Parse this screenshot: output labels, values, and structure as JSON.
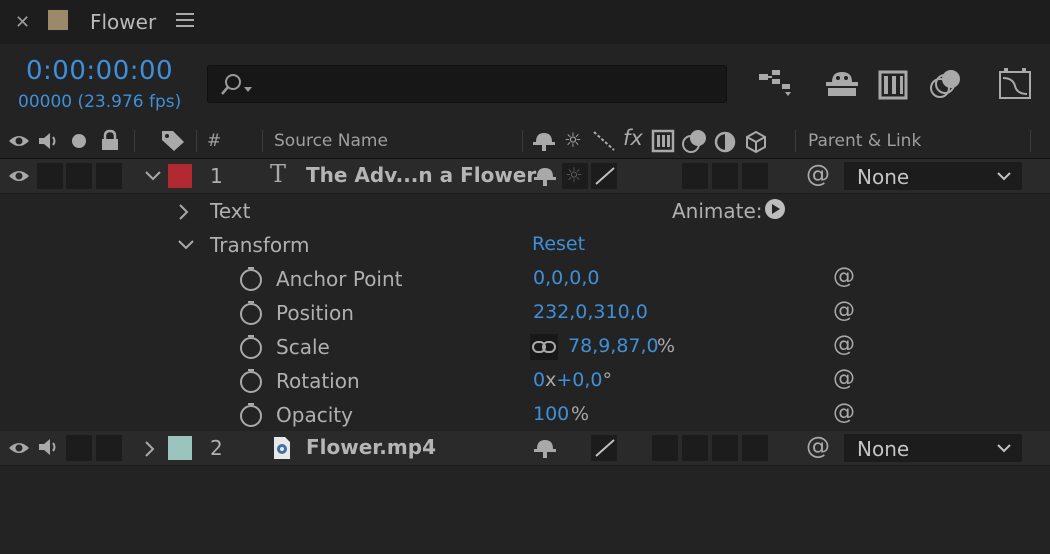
{
  "tab": {
    "title": "Flower",
    "swatch_color": "#9b8a6a"
  },
  "toolbar": {
    "timecode": "0:00:00:00",
    "frame_info": "00000 (23.976 fps)",
    "search_value": "",
    "search_placeholder": ""
  },
  "columns": {
    "number": "#",
    "source_name": "Source Name",
    "parent_link": "Parent & Link"
  },
  "layers": [
    {
      "number": "1",
      "name": "The Adv...n a Flower",
      "label_color": "#b12a31",
      "parent": "None"
    },
    {
      "number": "2",
      "name": "Flower.mp4",
      "label_color": "#9bc4bd",
      "parent": "None"
    }
  ],
  "properties": {
    "text_label": "Text",
    "animate_label": "Animate:",
    "transform_label": "Transform",
    "reset_label": "Reset",
    "anchor_point": {
      "label": "Anchor Point",
      "value": "0,0,0,0"
    },
    "position": {
      "label": "Position",
      "value": "232,0,310,0"
    },
    "scale": {
      "label": "Scale",
      "value": "78,9,87,0",
      "unit": "%"
    },
    "rotation": {
      "label": "Rotation",
      "rev": "0",
      "x": "x",
      "deg": "+0,0",
      "unit": "°"
    },
    "opacity": {
      "label": "Opacity",
      "value": "100",
      "unit": "%"
    }
  }
}
